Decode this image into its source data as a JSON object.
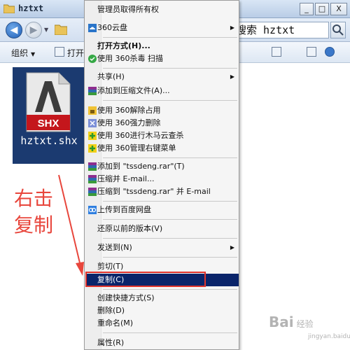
{
  "window": {
    "title": "hztxt",
    "buttons": [
      "_",
      "□",
      "X"
    ]
  },
  "address": {
    "search_text": "搜索 hztxt"
  },
  "toolbar": {
    "organize_label": "组织",
    "open_label": "打开"
  },
  "file": {
    "badge": "SHX",
    "name": "hztxt.shx"
  },
  "annotation": {
    "line1": "右击",
    "line2": "复制"
  },
  "menu": {
    "items": [
      {
        "label": "管理员取得所有权",
        "icon": "none"
      },
      {
        "label": "360云盘",
        "icon": "cloud-icon",
        "submenu": true
      },
      {
        "label": "打开方式(H)...",
        "icon": "none",
        "bold": true
      },
      {
        "label": "使用 360杀毒 扫描",
        "icon": "shield-icon"
      },
      {
        "label": "共享(H)",
        "icon": "none",
        "submenu": true
      },
      {
        "label": "添加到压缩文件(A)...",
        "icon": "archive-icon"
      },
      {
        "label": "使用 360解除占用",
        "icon": "unlock-icon"
      },
      {
        "label": "使用 360强力删除",
        "icon": "delete-icon"
      },
      {
        "label": "使用 360进行木马云查杀",
        "icon": "plus-icon"
      },
      {
        "label": "使用 360管理右键菜单",
        "icon": "plus-icon"
      },
      {
        "label": "添加到 \"tssdeng.rar\"(T)",
        "icon": "archive-icon"
      },
      {
        "label": "压缩并 E-mail...",
        "icon": "archive-icon"
      },
      {
        "label": "压缩到 \"tssdeng.rar\" 并 E-mail",
        "icon": "archive-icon"
      },
      {
        "label": "上传到百度网盘",
        "icon": "baidu-cloud-icon"
      },
      {
        "label": "还原以前的版本(V)",
        "icon": "none"
      },
      {
        "label": "发送到(N)",
        "icon": "none",
        "submenu": true
      },
      {
        "label": "剪切(T)",
        "icon": "none"
      },
      {
        "label": "复制(C)",
        "icon": "none",
        "highlighted": true
      },
      {
        "label": "创建快捷方式(S)",
        "icon": "none"
      },
      {
        "label": "删除(D)",
        "icon": "none"
      },
      {
        "label": "重命名(M)",
        "icon": "none"
      },
      {
        "label": "属性(R)",
        "icon": "none"
      }
    ]
  },
  "watermark": {
    "text": "Bai",
    "text2": "经验",
    "sub": "jingyan.baidu.com"
  },
  "colors": {
    "highlight": "#0a246a",
    "annotation": "#e8463c",
    "file_tile": "#1b3a70"
  }
}
